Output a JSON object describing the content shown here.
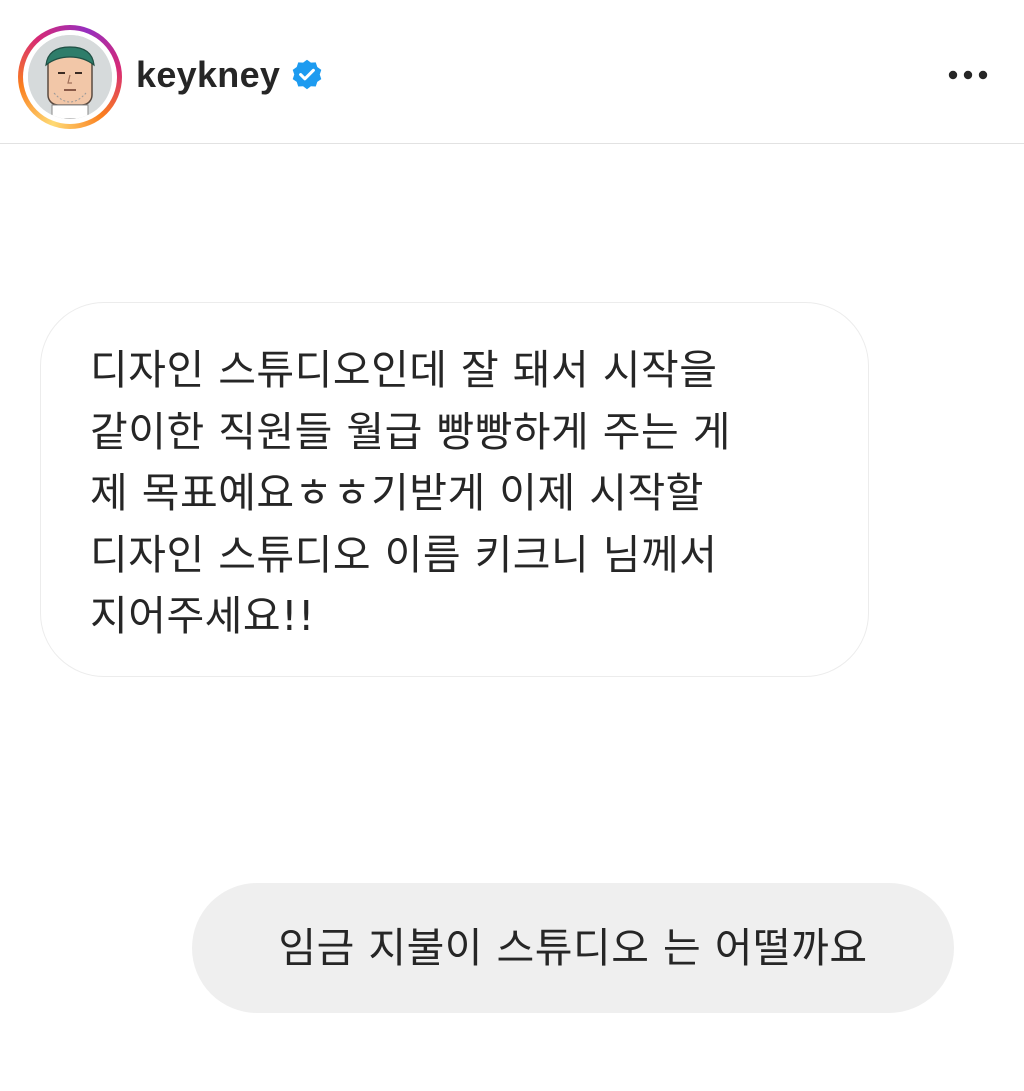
{
  "header": {
    "username": "keykney",
    "verified": true,
    "avatar_icon": "cartoon-face-avatar",
    "more_icon": "more-horizontal-icon",
    "verified_color": "#1d9bf0"
  },
  "messages": [
    {
      "direction": "received",
      "text": "디자인 스튜디오인데 잘 돼서 시작을\n같이한 직원들 월급 빵빵하게 주는 게\n제 목표예요ㅎㅎ기받게 이제 시작할\n디자인 스튜디오 이름 키크니 님께서\n지어주세요!!"
    },
    {
      "direction": "sent",
      "text": "임금 지불이 스튜디오 는 어떨까요"
    }
  ],
  "colors": {
    "text": "#262626",
    "sent_bubble": "#efefef",
    "received_border": "#ececec",
    "divider": "#e2e2e2"
  }
}
